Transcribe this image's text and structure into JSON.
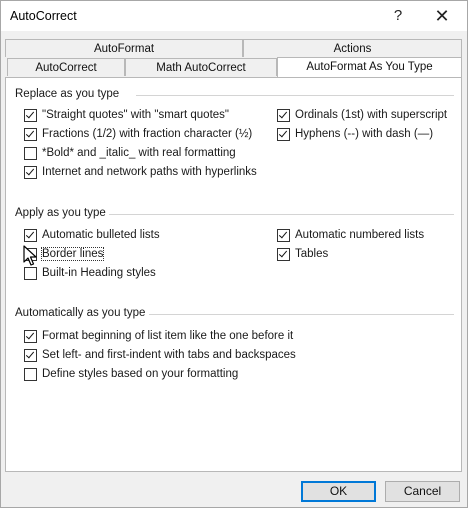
{
  "dialog": {
    "title": "AutoCorrect",
    "help_glyph": "?",
    "close_glyph": "✕"
  },
  "tabs": {
    "row1": [
      {
        "label": "AutoFormat",
        "active": false
      },
      {
        "label": "Actions",
        "active": false
      }
    ],
    "row2": [
      {
        "label": "AutoCorrect",
        "active": false
      },
      {
        "label": "Math AutoCorrect",
        "active": false
      },
      {
        "label": "AutoFormat As You Type",
        "active": true
      }
    ]
  },
  "sections": {
    "replace": {
      "title": "Replace as you type",
      "options": [
        {
          "label": "\"Straight quotes\" with \"smart quotes\"",
          "checked": true
        },
        {
          "label": "Ordinals (1st) with superscript",
          "checked": true
        },
        {
          "label": "Fractions (1/2) with fraction character (½)",
          "checked": true
        },
        {
          "label": "Hyphens (--) with dash (—)",
          "checked": true
        },
        {
          "label": "*Bold* and _italic_ with real formatting",
          "checked": false
        },
        {
          "label": "Internet and network paths with hyperlinks",
          "checked": true
        }
      ]
    },
    "apply": {
      "title": "Apply as you type",
      "options": [
        {
          "label": "Automatic bulleted lists",
          "checked": true
        },
        {
          "label": "Automatic numbered lists",
          "checked": true
        },
        {
          "label": "Border lines",
          "checked": false
        },
        {
          "label": "Tables",
          "checked": true
        },
        {
          "label": "Built-in Heading styles",
          "checked": false
        }
      ]
    },
    "automatic": {
      "title": "Automatically as you type",
      "options": [
        {
          "label": "Format beginning of list item like the one before it",
          "checked": true
        },
        {
          "label": "Set left- and first-indent with tabs and backspaces",
          "checked": true
        },
        {
          "label": "Define styles based on your formatting",
          "checked": false
        }
      ]
    }
  },
  "buttons": {
    "ok": "OK",
    "cancel": "Cancel"
  }
}
